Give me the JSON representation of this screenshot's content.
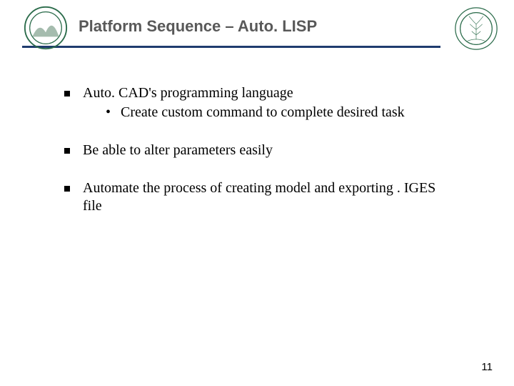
{
  "header": {
    "title": "Platform Sequence – Auto. LISP"
  },
  "bullets": [
    {
      "text": "Auto. CAD's programming language",
      "children": [
        {
          "text": "Create custom command to complete desired task"
        }
      ]
    },
    {
      "text": "Be able to alter parameters easily"
    },
    {
      "text": "Automate the process of creating model and exporting . IGES file"
    }
  ],
  "page_number": "11"
}
